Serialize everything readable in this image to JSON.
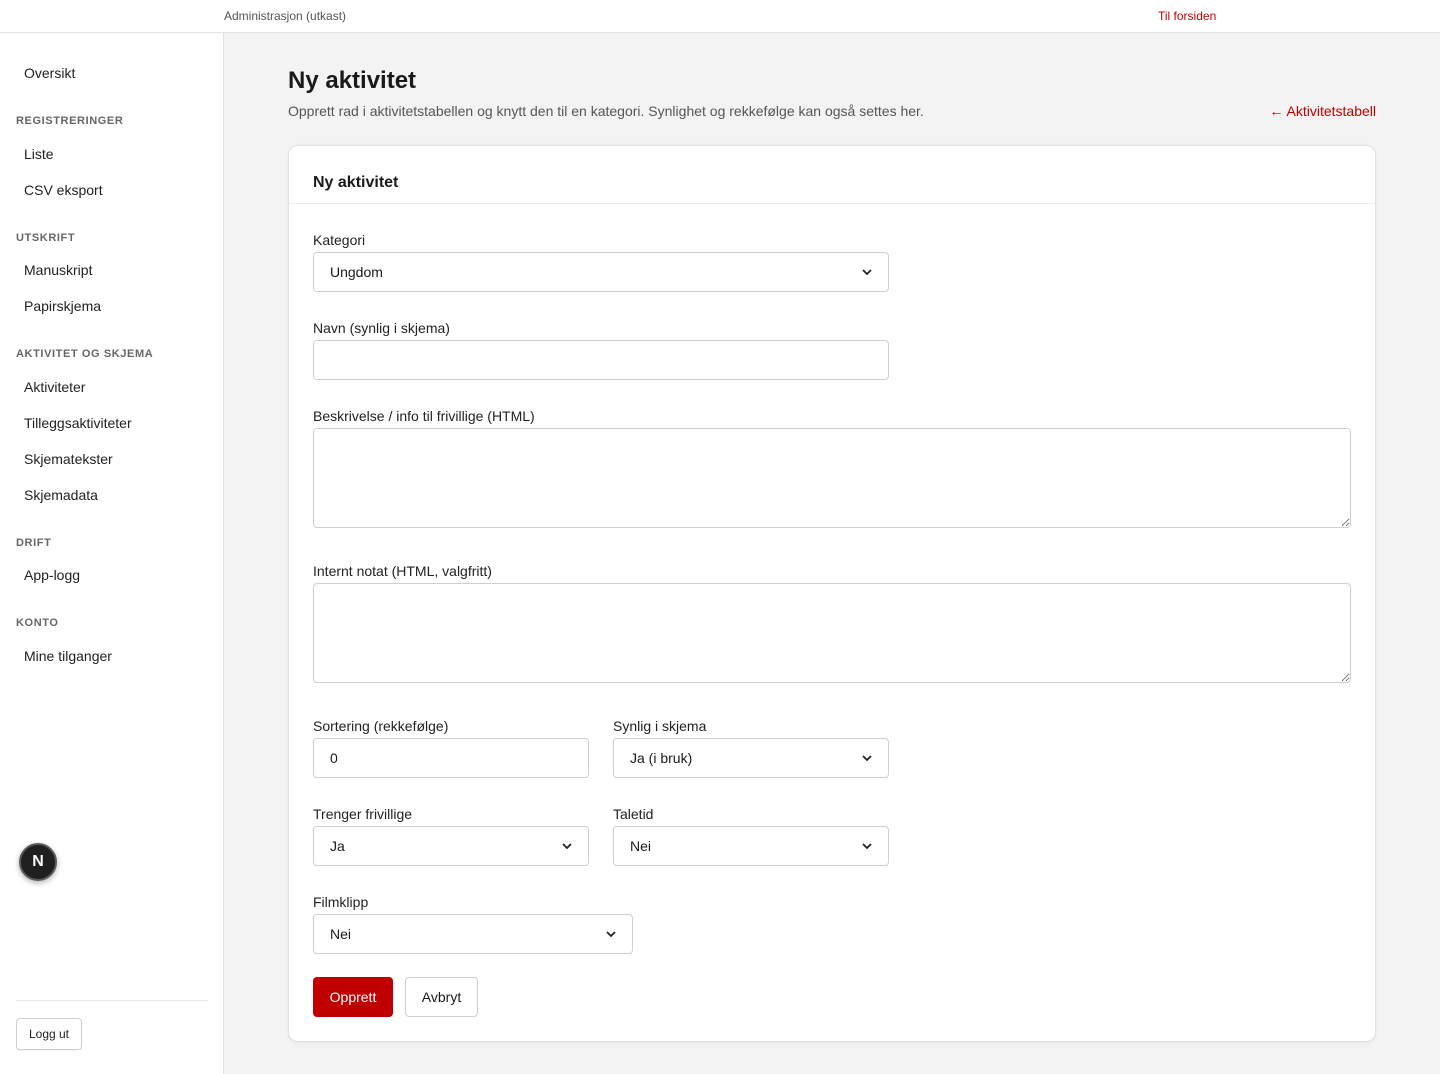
{
  "topbar": {
    "app_title": "Administrasjon (utkast)",
    "home_link": "Til forsiden"
  },
  "sidebar": {
    "items": [
      {
        "label": "Oversikt"
      },
      {
        "section": "REGISTRERINGER"
      },
      {
        "label": "Liste"
      },
      {
        "label": "CSV eksport"
      },
      {
        "section": "UTSKRIFT"
      },
      {
        "label": "Manuskript"
      },
      {
        "label": "Papirskjema"
      },
      {
        "section": "AKTIVITET OG SKJEMA"
      },
      {
        "label": "Aktiviteter"
      },
      {
        "label": "Tilleggsaktiviteter"
      },
      {
        "label": "Skjematekster"
      },
      {
        "label": "Skjemadata"
      },
      {
        "section": "DRIFT"
      },
      {
        "label": "App-logg"
      },
      {
        "section": "KONTO"
      },
      {
        "label": "Mine tilganger"
      }
    ],
    "logout_label": "Logg ut",
    "badge_letter": "N"
  },
  "page": {
    "title": "Ny aktivitet",
    "subtitle": "Opprett rad i aktivitetstabellen og knytt den til en kategori. Synlighet og rekkefølge kan også settes her.",
    "back_link": "← Aktivitetstabell"
  },
  "form": {
    "card_title": "Ny aktivitet",
    "kategori": {
      "label": "Kategori",
      "value": "Ungdom"
    },
    "navn": {
      "label": "Navn (synlig i skjema)",
      "value": ""
    },
    "beskrivelse": {
      "label": "Beskrivelse / info til frivillige (HTML)",
      "value": ""
    },
    "notat": {
      "label": "Internt notat (HTML, valgfritt)",
      "value": ""
    },
    "sortering": {
      "label": "Sortering (rekkefølge)",
      "value": "0"
    },
    "synlig": {
      "label": "Synlig i skjema",
      "value": "Ja (i bruk)"
    },
    "trenger": {
      "label": "Trenger frivillige",
      "value": "Ja"
    },
    "taletid": {
      "label": "Taletid",
      "value": "Nei"
    },
    "filmklipp": {
      "label": "Filmklipp",
      "value": "Nei"
    },
    "submit_label": "Opprett",
    "cancel_label": "Avbryt"
  },
  "colors": {
    "accent": "#c00000",
    "background": "#f3f3f3"
  }
}
